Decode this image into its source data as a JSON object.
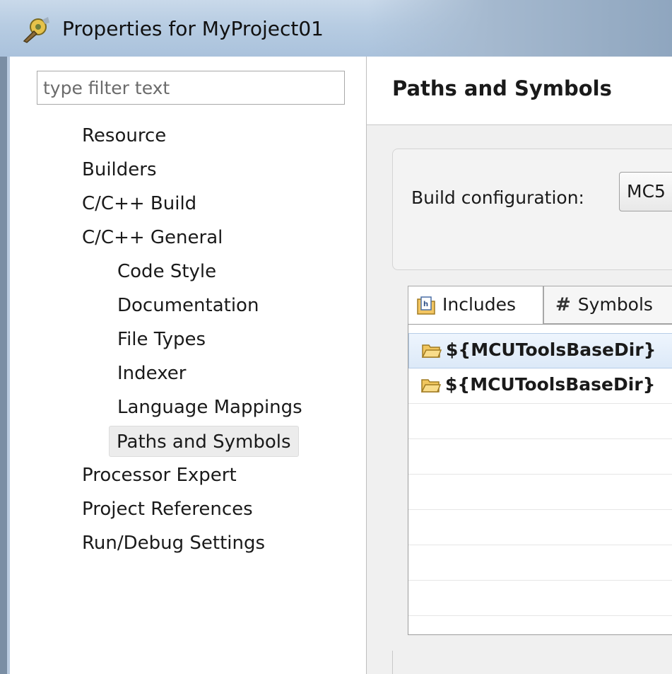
{
  "window": {
    "title": "Properties for MyProject01",
    "icon": "eclipse-properties-icon"
  },
  "sidebar": {
    "filter_placeholder": "type filter text",
    "items": [
      {
        "label": "Resource",
        "level": 0
      },
      {
        "label": "Builders",
        "level": 0
      },
      {
        "label": "C/C++ Build",
        "level": 0
      },
      {
        "label": "C/C++ General",
        "level": 0
      },
      {
        "label": "Code Style",
        "level": 1
      },
      {
        "label": "Documentation",
        "level": 1
      },
      {
        "label": "File Types",
        "level": 1
      },
      {
        "label": "Indexer",
        "level": 1
      },
      {
        "label": "Language Mappings",
        "level": 1
      },
      {
        "label": "Paths and Symbols",
        "level": 1,
        "selected": true
      },
      {
        "label": "Processor Expert",
        "level": 0
      },
      {
        "label": "Project References",
        "level": 0
      },
      {
        "label": "Run/Debug Settings",
        "level": 0
      }
    ]
  },
  "page": {
    "title": "Paths and Symbols",
    "build_config_label": "Build configuration:",
    "build_config_value": "MC5",
    "tabs": [
      {
        "label": "Includes",
        "icon": "includes-icon",
        "active": true
      },
      {
        "label": "Symbols",
        "icon": "hash-icon",
        "active": false
      }
    ],
    "include_paths": [
      {
        "text": "${MCUToolsBaseDir}",
        "icon": "folder-icon",
        "selected": true
      },
      {
        "text": "${MCUToolsBaseDir}",
        "icon": "folder-icon",
        "selected": false
      }
    ]
  },
  "colors": {
    "titlebar": "#b7cce2",
    "selection": "#dce9f8",
    "tree_selection": "#ececec"
  }
}
